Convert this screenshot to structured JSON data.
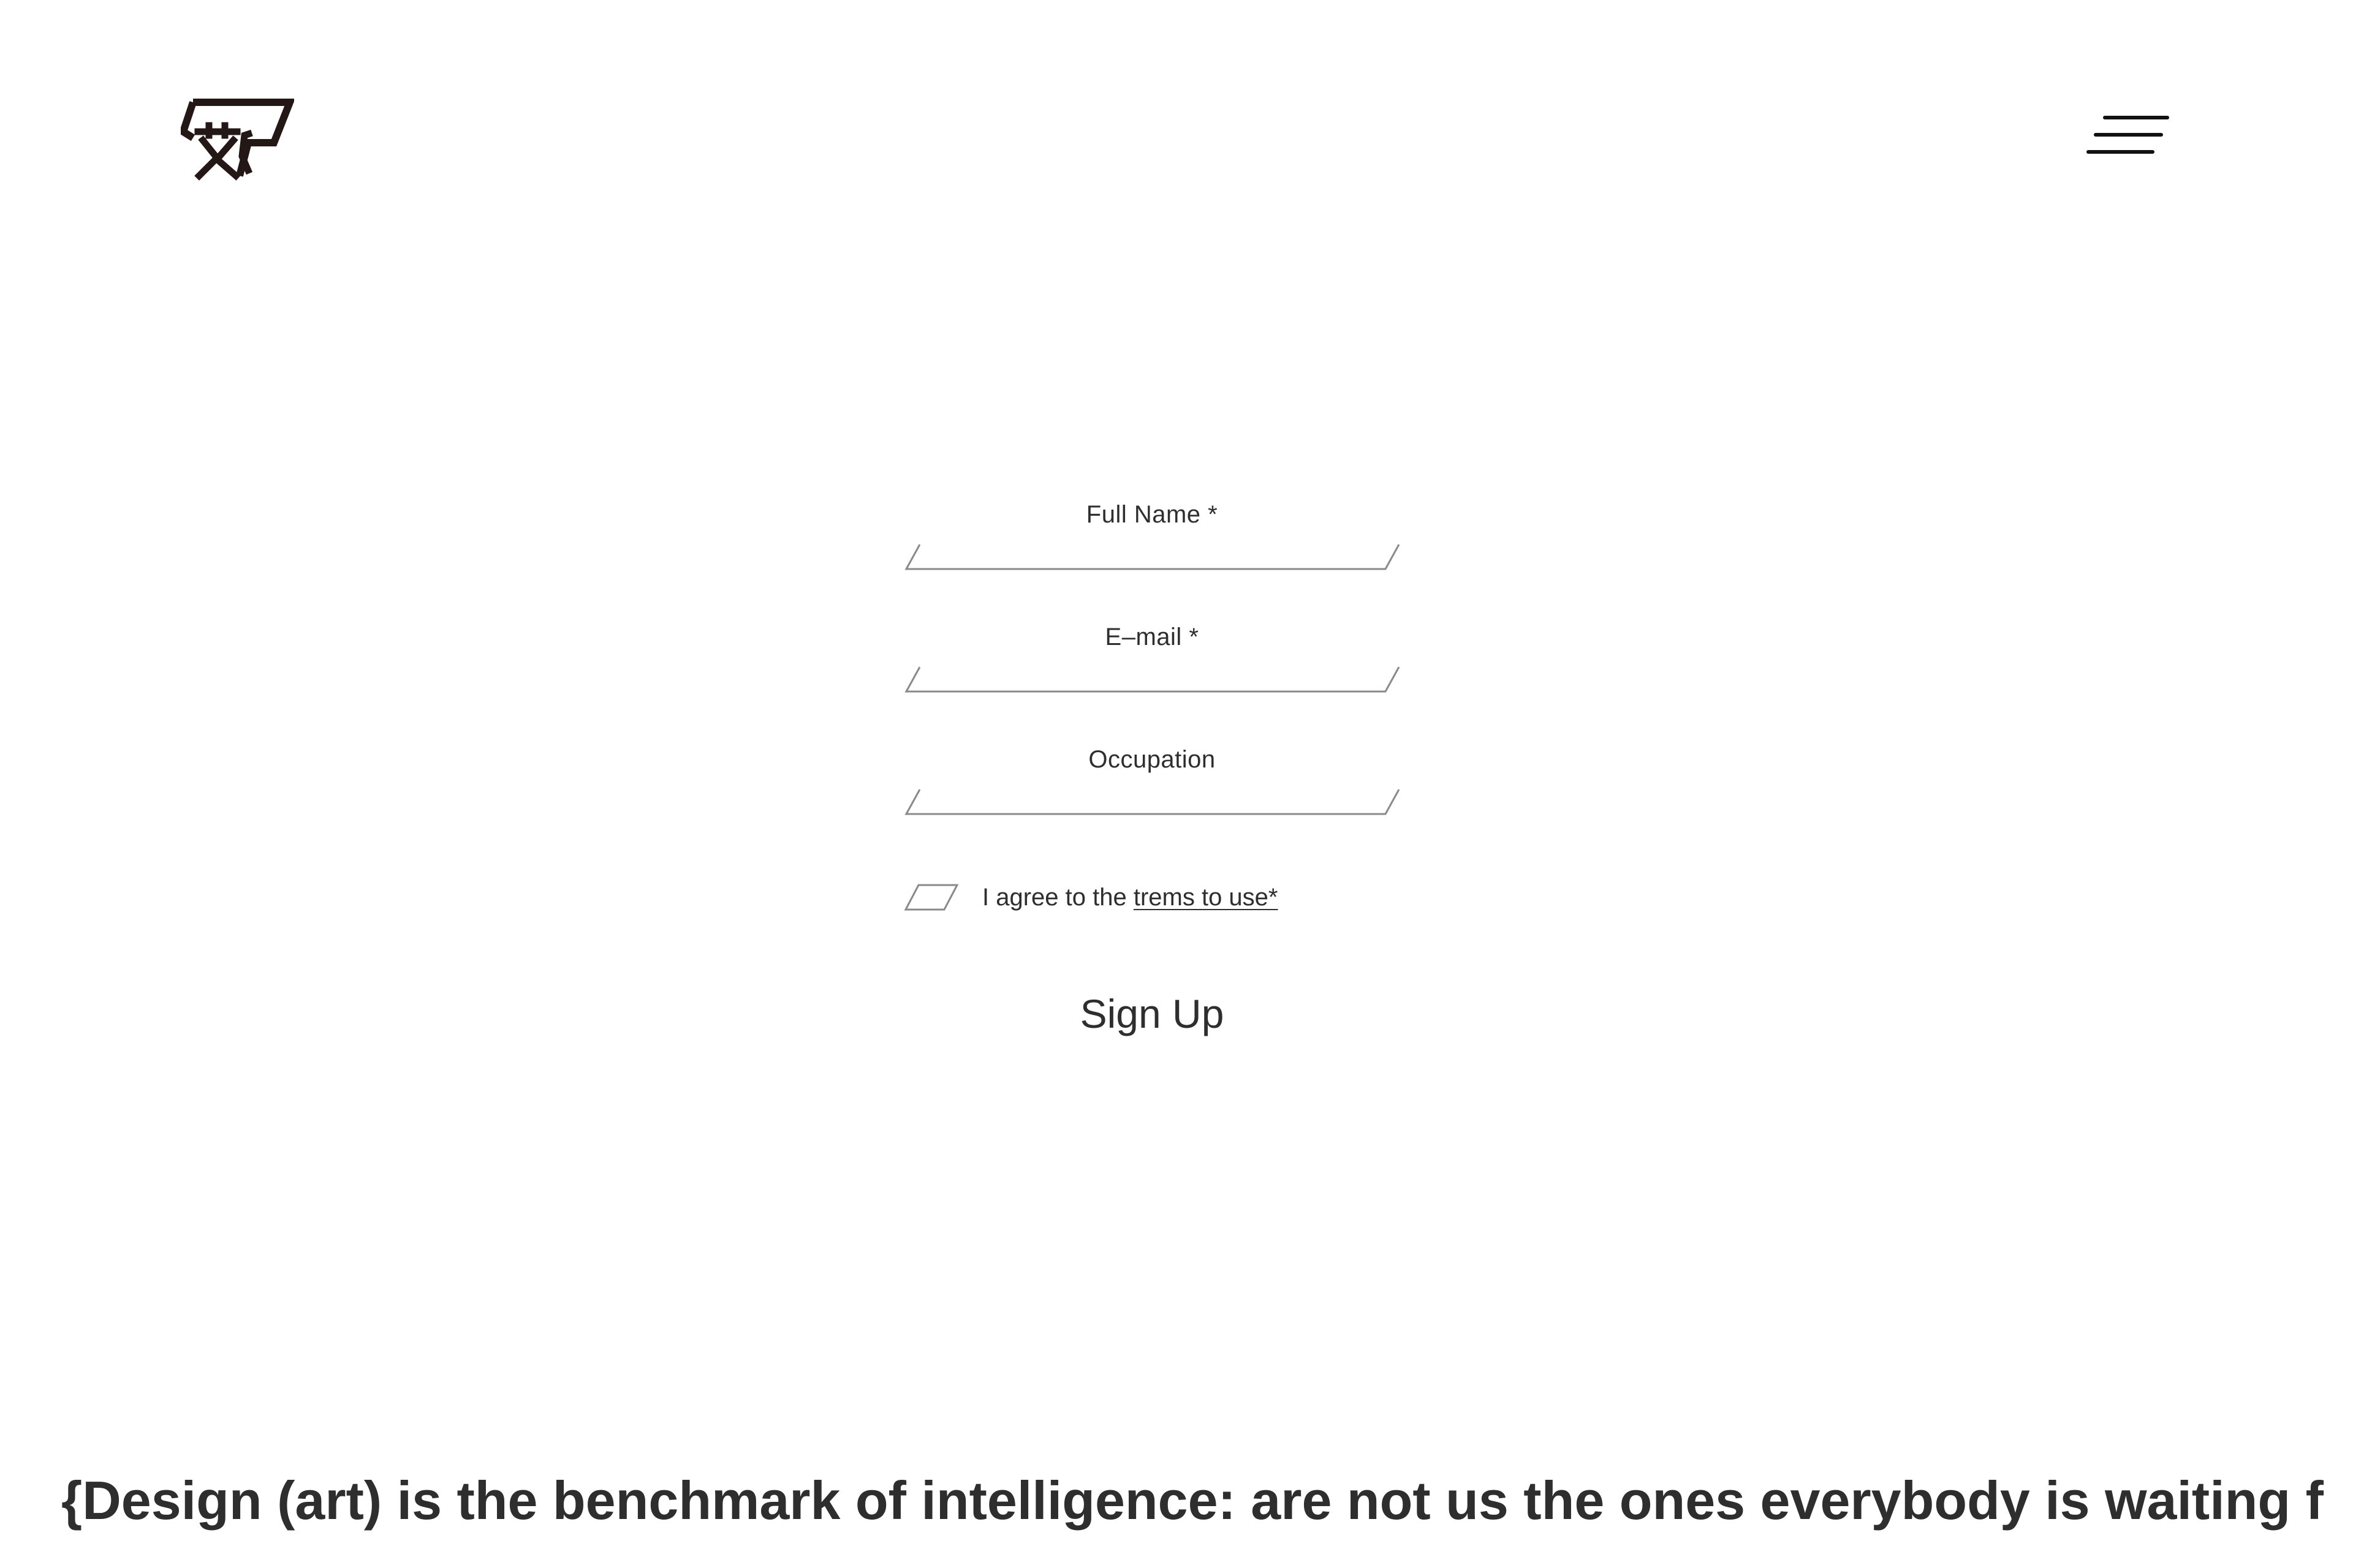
{
  "header": {
    "logo_icon": "brand-logo-icon",
    "menu_icon": "hamburger-menu-icon"
  },
  "form": {
    "full_name_label": "Full Name *",
    "email_label": "E–mail *",
    "occupation_label": "Occupation",
    "agree_prefix": "I agree to the ",
    "terms_link": "trems to use*",
    "signup_label": "Sign Up"
  },
  "tagline": {
    "text": "{Design (art) is the benchmark of intelligence: are not us the ones everybody is waiting f"
  },
  "colors": {
    "text": "#2e2e2e",
    "line": "#8a8a8a",
    "background": "#ffffff"
  }
}
